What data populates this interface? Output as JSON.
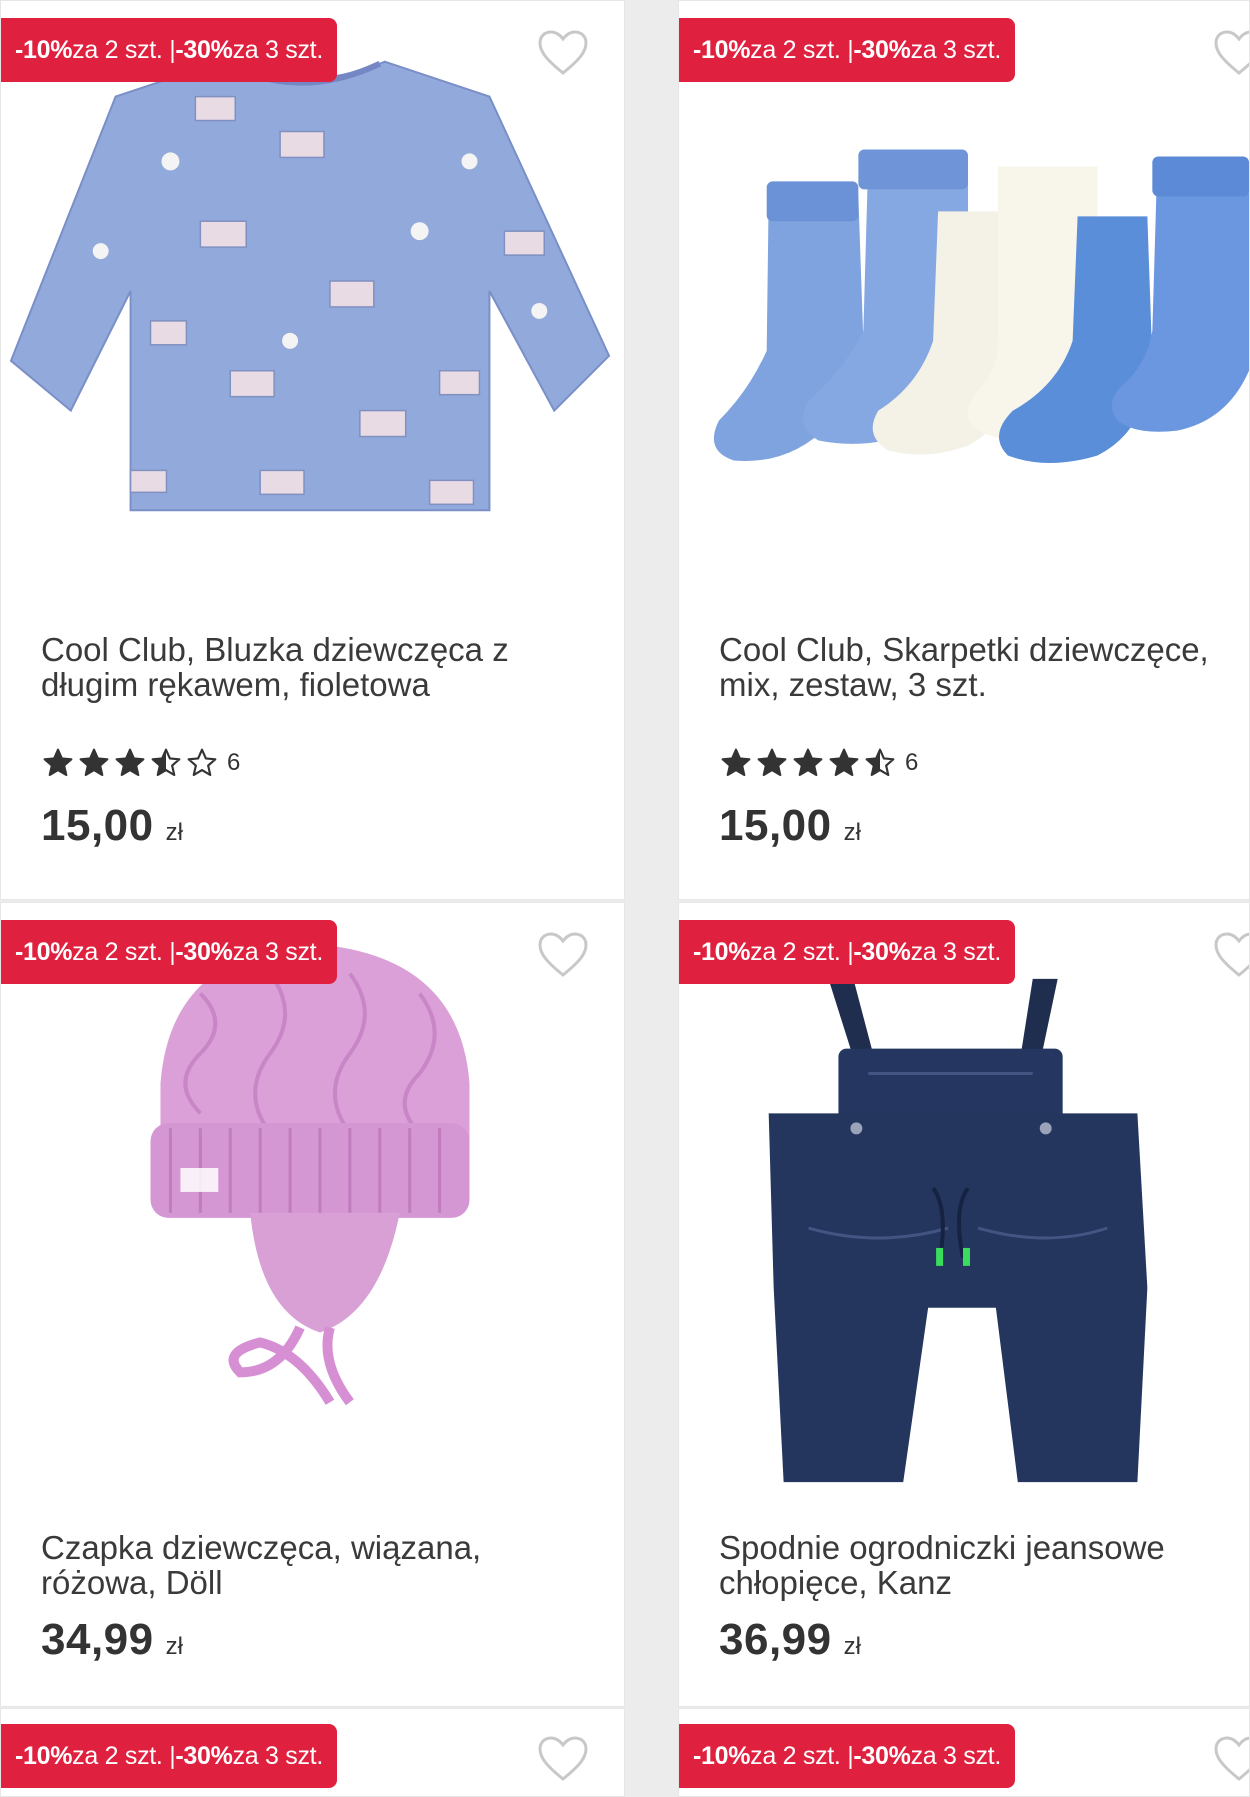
{
  "promo": {
    "part1_pct": "-10%",
    "part1_rest": " za 2 szt. | ",
    "part2_pct": "-30%",
    "part2_rest": " za 3 szt."
  },
  "products": [
    {
      "title": "Cool Club, Bluzka dziewczęca z długim rękawem, fioletowa",
      "rating": 3.5,
      "reviews": "6",
      "price": "15,00",
      "currency": "zł",
      "image": "blue-girls-longsleeve-top-with-house-print"
    },
    {
      "title": "Cool Club, Skarpetki dziewczęce, mix, zestaw, 3 szt.",
      "rating": 4.5,
      "reviews": "6",
      "price": "15,00",
      "currency": "zł",
      "image": "three-pairs-of-socks-blue-white"
    },
    {
      "title": "Czapka dziewczęca, wiązana, różowa, Döll",
      "price": "34,99",
      "currency": "zł",
      "image": "pink-knitted-hat-with-ties"
    },
    {
      "title": "Spodnie ogrodniczki jeansowe chłopięce, Kanz",
      "price": "36,99",
      "currency": "zł",
      "image": "dark-denim-dungarees"
    },
    {
      "image": "partial-product-image"
    },
    {
      "image": "partial-product-image"
    }
  ],
  "colors": {
    "badge": "#e0203f",
    "star": "#333333",
    "card_bg": "#ffffff",
    "page_bg": "#ececec"
  }
}
